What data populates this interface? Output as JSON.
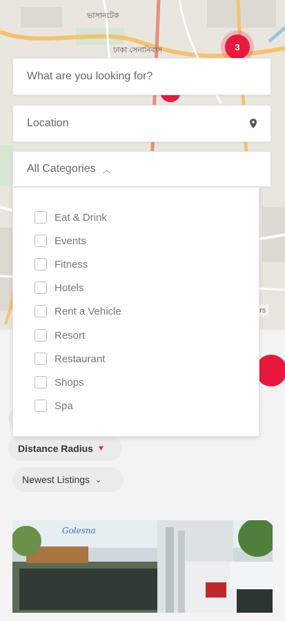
{
  "map": {
    "labels": [
      "ভাসানটেক",
      "ঢাকা সেনানিবাস"
    ],
    "cluster_count": "3",
    "contrib": "ors"
  },
  "search": {
    "placeholder": "What are you looking for?",
    "location_placeholder": "Location",
    "categories_label": "All Categories"
  },
  "categories": [
    "Eat & Drink",
    "Events",
    "Fitness",
    "Hotels",
    "Rent a Vehicle",
    "Resort",
    "Restaurant",
    "Shops",
    "Spa"
  ],
  "filters": {
    "distance_label": "Distance Radius",
    "sort_label": "Newest Listings"
  },
  "listing": {
    "sign_text": "Golesna"
  },
  "colors": {
    "accent": "#e8193c",
    "map_bg": "#e9e6df",
    "road": "#f4c36e"
  },
  "icons": [
    "map-pin-icon",
    "chevron-up-icon",
    "chevron-down-icon",
    "checkbox-icon"
  ]
}
